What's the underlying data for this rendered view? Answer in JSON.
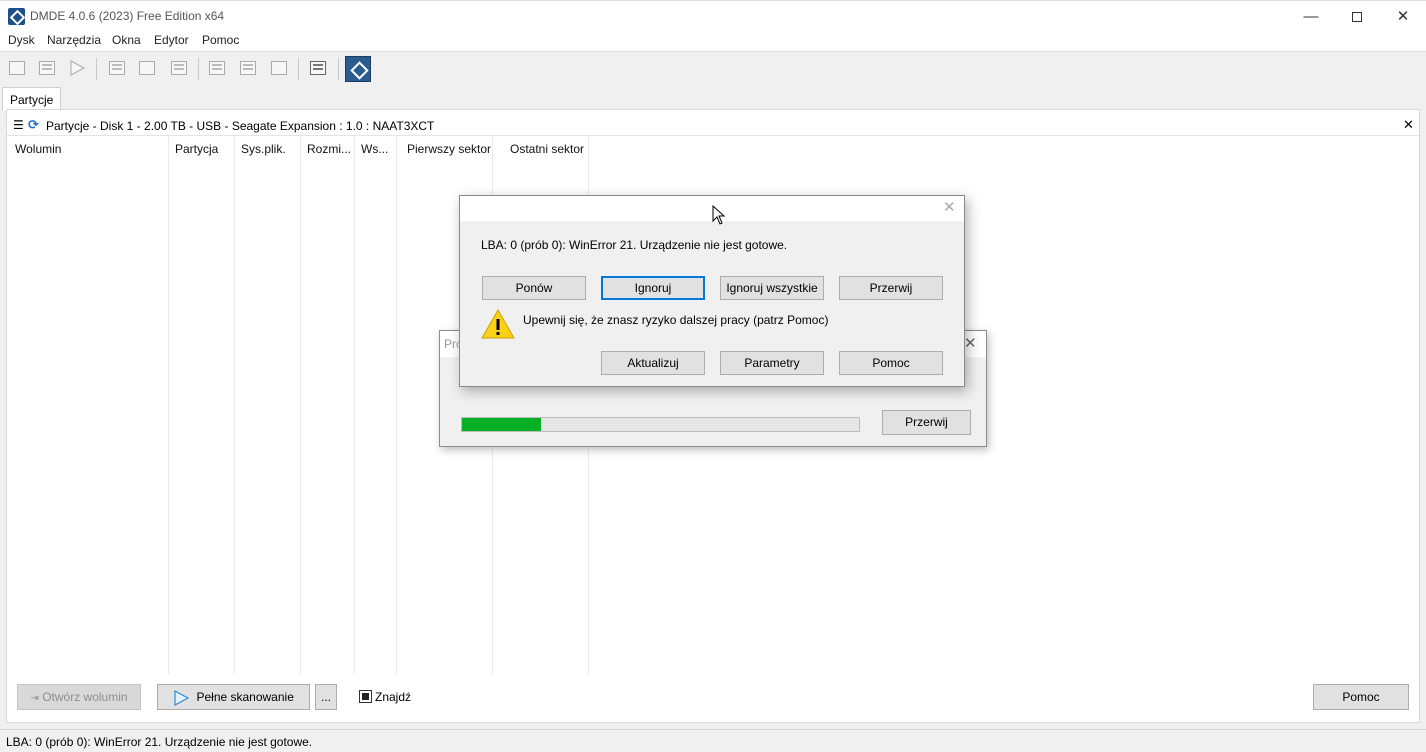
{
  "window": {
    "title": "DMDE 4.0.6 (2023) Free Edition x64",
    "minimize": "—",
    "close": "✕"
  },
  "menu": [
    "Dysk",
    "Narzędzia",
    "Okna",
    "Edytor",
    "Pomoc"
  ],
  "tabs": [
    {
      "label": "Partycje"
    }
  ],
  "panel": {
    "title": "Partycje - Disk 1 - 2.00 TB - USB - Seagate Expansion : 1.0 : NAAT3XCT",
    "close": "✕",
    "columns": [
      "Wolumin",
      "Partycja",
      "Sys.plik.",
      "Rozmi...",
      "Ws...",
      "Pierwszy sektor",
      "Ostatni sektor"
    ]
  },
  "bottom": {
    "open_volume": "Otwórz wolumin",
    "full_scan": "Pełne skanowanie",
    "more": "...",
    "find": "Znajdź",
    "help": "Pomoc"
  },
  "status": "LBA: 0 (prób 0): WinError 21. Urządzenie nie jest gotowe.",
  "progress_dialog": {
    "title": "Pro",
    "cancel": "Przerwij",
    "progress": 0.2,
    "bar_color": "#06b025",
    "close": "✕"
  },
  "error_dialog": {
    "message": "LBA: 0 (prób 0): WinError 21. Urządzenie nie jest gotowe.",
    "buttons": [
      "Ponów",
      "Ignoruj",
      "Ignoruj wszystkie",
      "Przerwij"
    ],
    "warning": "Upewnij się, że znasz ryzyko dalszej pracy (patrz Pomoc)",
    "buttons2": [
      "Aktualizuj",
      "Parametry",
      "Pomoc"
    ],
    "close": "✕"
  }
}
